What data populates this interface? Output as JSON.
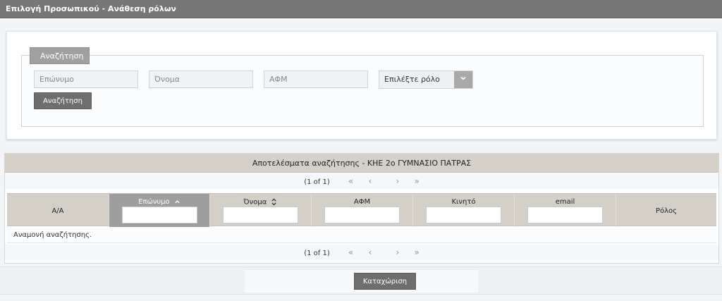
{
  "title": "Επιλογή Προσωπικού - Ανάθεση ρόλων",
  "search": {
    "legend": "Αναζήτηση",
    "surname_placeholder": "Επώνυμο",
    "name_placeholder": "Όνομα",
    "afm_placeholder": "ΑΦΜ",
    "role_select": "Επιλέξτε ρόλο",
    "search_button": "Αναζήτηση"
  },
  "results": {
    "header": "Αποτελέσματα αναζήτησης - ΚΗΕ 2ο ΓΥΜΝΑΣΙΟ ΠΑΤΡΑΣ",
    "pager_text": "(1 of 1)",
    "pager_first": "«",
    "pager_prev": "‹",
    "pager_next": "›",
    "pager_last": "»",
    "columns": {
      "aa": "Α/Α",
      "surname": "Επώνυμο",
      "name": "Όνομα",
      "afm": "ΑΦΜ",
      "mobile": "Κινητό",
      "email": "email",
      "role": "Ρόλος"
    },
    "empty_message": "Αναμονή αναζήτησης."
  },
  "footer": {
    "submit_button": "Καταχώριση"
  },
  "colors": {
    "titlebar": "#767676",
    "table_header": "#d4d0c8",
    "sorted_column": "#9e9e9e",
    "button": "#6e6e6e"
  }
}
